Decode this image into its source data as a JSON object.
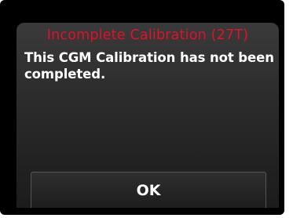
{
  "dialog": {
    "title": "Incomplete Calibration (27T)",
    "message": "This CGM Calibration has not been completed.",
    "ok_label": "OK"
  },
  "colors": {
    "title": "#e0112a",
    "message": "#ffffff",
    "background": "#000000"
  }
}
